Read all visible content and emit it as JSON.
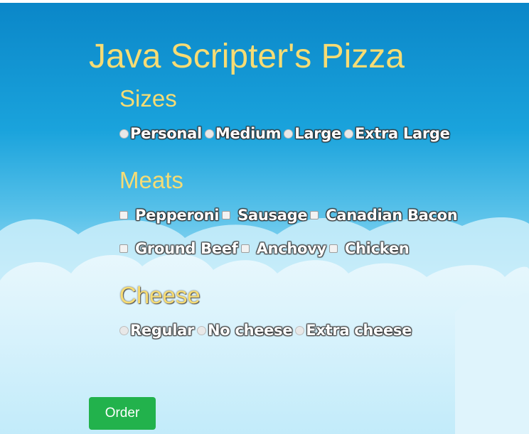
{
  "title": "Java Scripter's Pizza",
  "sizes": {
    "heading": "Sizes",
    "options": [
      "Personal",
      "Medium",
      "Large",
      "Extra Large"
    ]
  },
  "meats": {
    "heading": "Meats",
    "row1": [
      "Pepperoni",
      "Sausage",
      "Canadian Bacon"
    ],
    "row2": [
      "Ground Beef",
      "Anchovy",
      "Chicken"
    ]
  },
  "cheese": {
    "heading": "Cheese",
    "options": [
      "Regular",
      "No cheese",
      "Extra cheese"
    ]
  },
  "order_button": "Order",
  "colors": {
    "heading": "#f6dc74",
    "button": "#22b24c",
    "sky_top": "#0a86c8"
  }
}
